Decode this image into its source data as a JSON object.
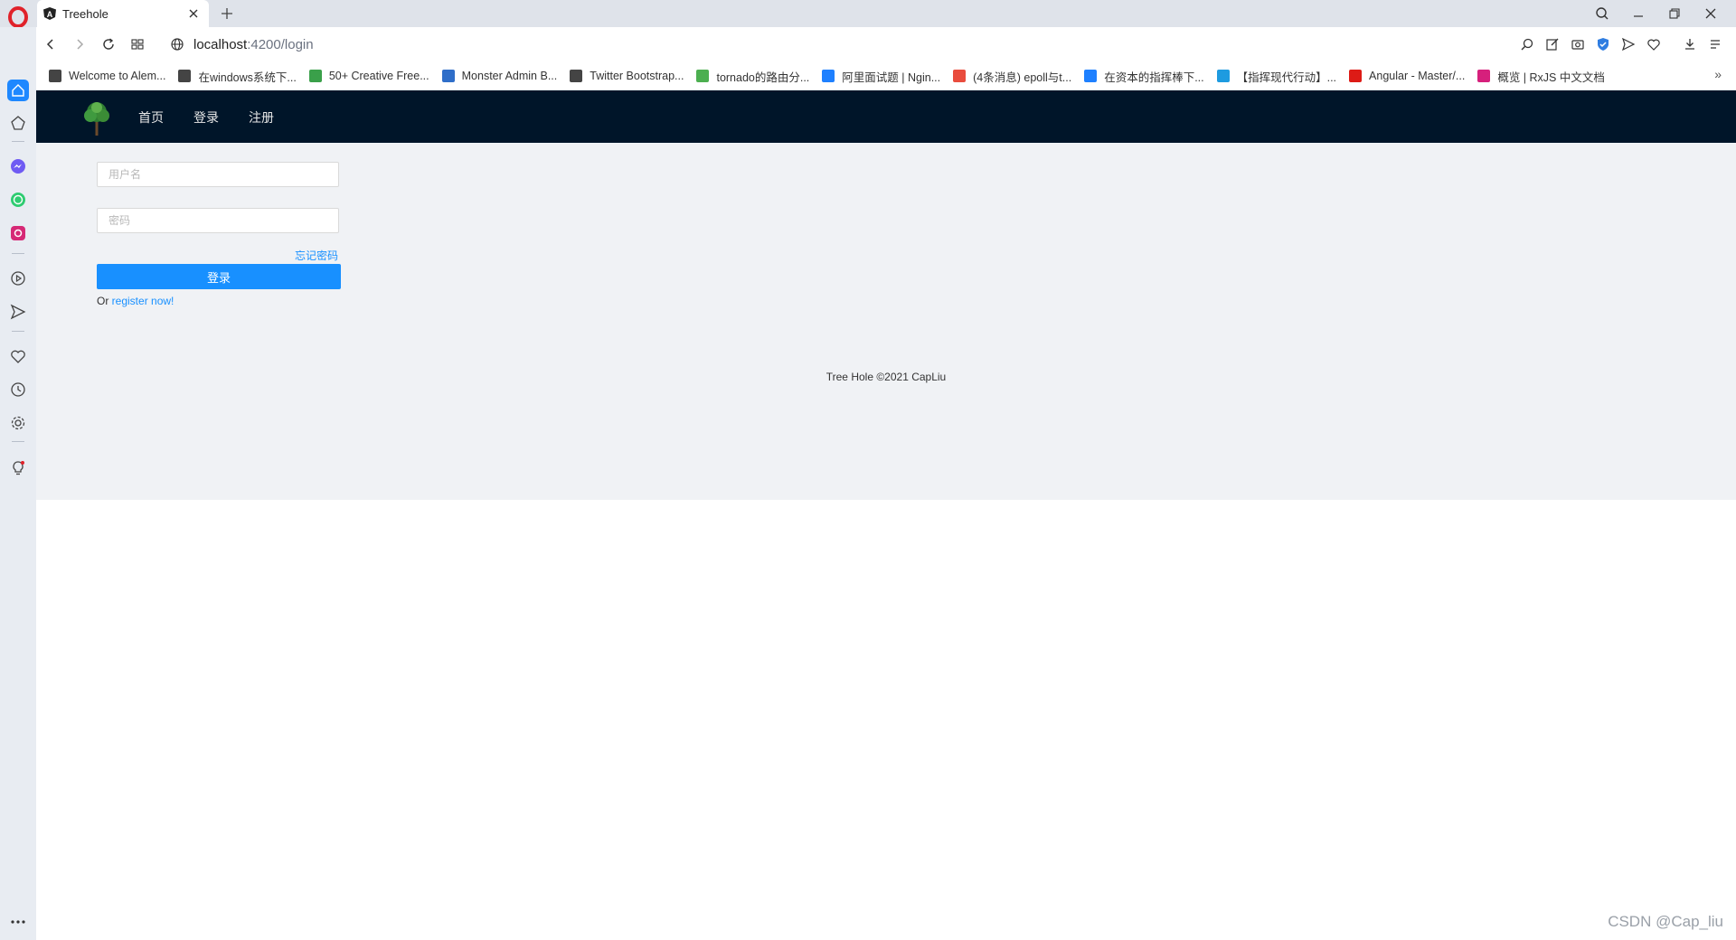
{
  "browser": {
    "tab_title": "Treehole",
    "url_host": "localhost",
    "url_path": ":4200/login",
    "bookmarks": [
      {
        "label": "Welcome to Alem...",
        "icon": "document-icon",
        "color": "#444444"
      },
      {
        "label": "在windows系统下...",
        "icon": "edit-icon",
        "color": "#444444"
      },
      {
        "label": "50+ Creative Free...",
        "icon": "leaf-icon",
        "color": "#3aa04a"
      },
      {
        "label": "Monster Admin B...",
        "icon": "leaf-icon",
        "color": "#2f6ec9"
      },
      {
        "label": "Twitter Bootstrap...",
        "icon": "document-icon",
        "color": "#444444"
      },
      {
        "label": "tornado的路由分...",
        "icon": "site-icon",
        "color": "#4caf50"
      },
      {
        "label": "阿里面试题 | Ngin...",
        "icon": "zhihu-icon",
        "color": "#1e80ff"
      },
      {
        "label": "(4条消息) epoll与t...",
        "icon": "csdn-icon",
        "color": "#e94c3d"
      },
      {
        "label": "在资本的指挥棒下...",
        "icon": "zhihu-icon",
        "color": "#1e80ff"
      },
      {
        "label": "【指挥现代行动】...",
        "icon": "bilibili-icon",
        "color": "#1e9be0"
      },
      {
        "label": "Angular - Master/...",
        "icon": "angular-icon",
        "color": "#dd1b16"
      },
      {
        "label": "概览 | RxJS 中文文档",
        "icon": "rxjs-icon",
        "color": "#d6207c"
      }
    ]
  },
  "app": {
    "nav": [
      "首页",
      "登录",
      "注册"
    ],
    "username_placeholder": "用户名",
    "password_placeholder": "密码",
    "forgot_label": "忘记密码",
    "login_label": "登录",
    "register_prefix": "Or ",
    "register_link": "register now!",
    "footer": "Tree Hole ©2021 CapLiu"
  },
  "watermark": "CSDN @Cap_liu",
  "colors": {
    "header": "#001529",
    "primary": "#1890ff",
    "content_bg": "#f0f2f5"
  }
}
